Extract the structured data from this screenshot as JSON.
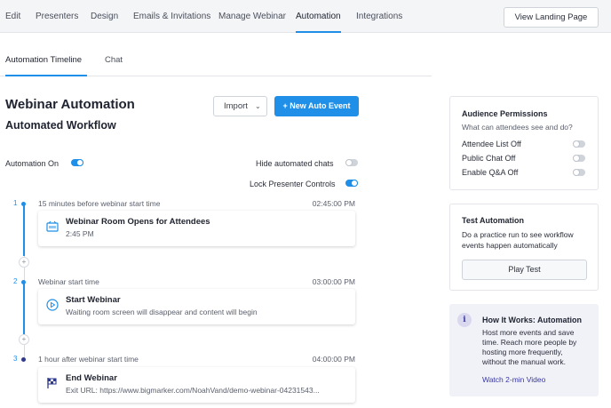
{
  "topnav": {
    "tabs": [
      {
        "label": "Edit"
      },
      {
        "label": "Presenters"
      },
      {
        "label": "Design"
      },
      {
        "label": "Emails & Invitations"
      },
      {
        "label": "Manage Webinar"
      },
      {
        "label": "Automation",
        "active": true
      },
      {
        "label": "Integrations"
      }
    ],
    "view_landing": "View Landing Page"
  },
  "subtabs": [
    {
      "label": "Automation Timeline",
      "active": true
    },
    {
      "label": "Chat"
    }
  ],
  "main": {
    "title": "Webinar Automation",
    "subtitle": "Automated Workflow",
    "import_label": "Import",
    "new_event_label": "+ New Auto Event",
    "automation_on_label": "Automation On",
    "automation_on": true,
    "hide_chats_label": "Hide automated chats",
    "hide_chats": false,
    "lock_controls_label": "Lock Presenter Controls",
    "lock_controls": true
  },
  "timeline": [
    {
      "num": "1",
      "when": "15 minutes before webinar start time",
      "time": "02:45:00 PM",
      "icon": "webinar-room-open-icon",
      "title": "Webinar Room Opens for Attendees",
      "detail": "2:45 PM"
    },
    {
      "num": "2",
      "when": "Webinar start time",
      "time": "03:00:00 PM",
      "icon": "play-icon",
      "title": "Start Webinar",
      "detail": "Waiting room screen will disappear and content will begin"
    },
    {
      "num": "3",
      "when": "1 hour after webinar start time",
      "time": "04:00:00 PM",
      "icon": "end-flag-icon",
      "title": "End Webinar",
      "detail": "Exit URL: https://www.bigmarker.com/NoahVand/demo-webinar-04231543..."
    }
  ],
  "audience": {
    "title": "Audience Permissions",
    "subtitle": "What can attendees see and do?",
    "items": [
      {
        "label": "Attendee List Off",
        "on": false
      },
      {
        "label": "Public Chat Off",
        "on": false
      },
      {
        "label": "Enable Q&A Off",
        "on": false
      }
    ]
  },
  "test": {
    "title": "Test Automation",
    "lines": [
      "Do a practice run to see workflow",
      "events happen automatically"
    ],
    "button": "Play Test"
  },
  "info": {
    "title": "How It Works: Automation",
    "lines": [
      "Host more events and save",
      "time. Reach more people by",
      "hosting more frequently,",
      "without the manual work."
    ],
    "link": "Watch 2-min Video"
  },
  "colors": {
    "accent": "#1f8fe8",
    "info_bg": "#f1f1f8",
    "link": "#3a3aa0"
  }
}
